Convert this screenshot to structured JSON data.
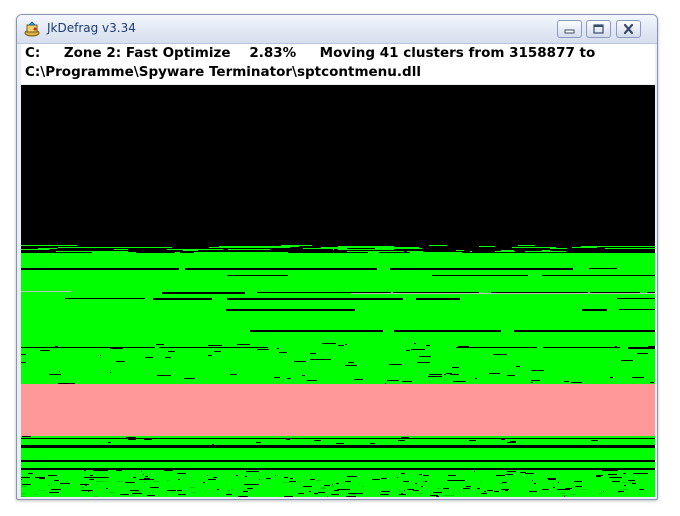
{
  "window": {
    "title": "JkDefrag v3.34",
    "icon": "jkdefrag-app-icon"
  },
  "title_controls": {
    "minimize_icon": "minimize-icon",
    "maximize_icon": "maximize-icon",
    "close_icon": "close-icon"
  },
  "status": {
    "drive": "C:",
    "zone": "Zone 2: Fast Optimize",
    "percent": "2.83%",
    "action": "Moving 41 clusters from 3158877 to",
    "file": "C:\\Programme\\Spyware Terminator\\sptcontmenu.dll"
  },
  "colors": {
    "empty": "#000000",
    "used": "#00ff00",
    "used_dark": "#00d000",
    "unmovable": "#ff9999",
    "gray": "#c0c0c0"
  }
}
